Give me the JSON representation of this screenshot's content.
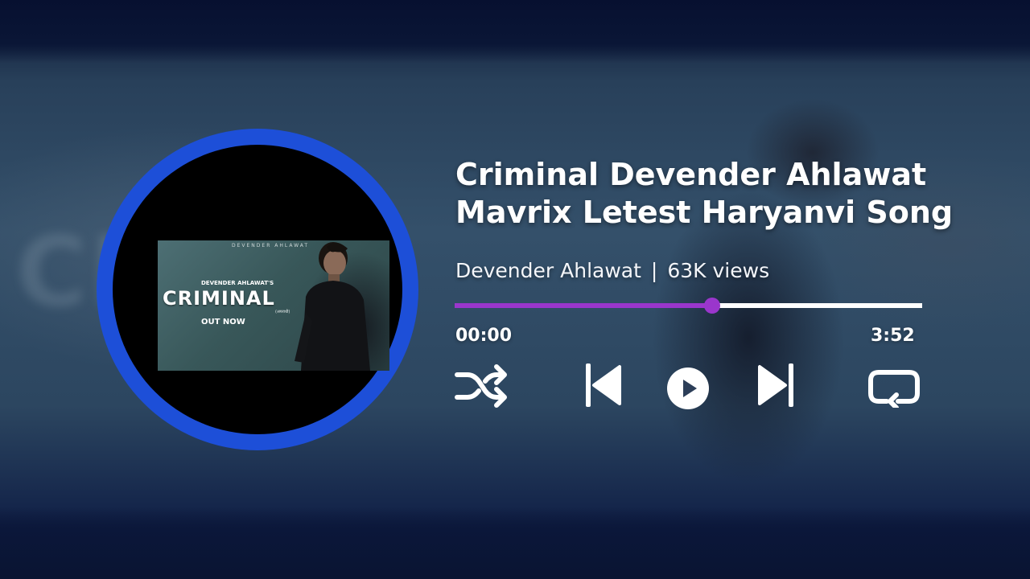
{
  "song": {
    "title_line1": "Criminal Devender Ahlawat",
    "title_line2": "Mavrix Letest Haryanvi Song",
    "artist": "Devender Ahlawat",
    "separator": "|",
    "views": "63K views"
  },
  "cover": {
    "top_text": "DEVENDER AHLAWAT",
    "artist_text": "DEVENDER AHLAWAT'S",
    "title_text": "CRIMINAL",
    "subtitle_text": "(अपराधी)",
    "release_text": "OUT NOW"
  },
  "background": {
    "ghost_text": "CRI"
  },
  "player": {
    "current_time": "00:00",
    "total_time": "3:52",
    "progress_fraction": 0.55,
    "controls": [
      "shuffle-icon",
      "previous-icon",
      "play-icon",
      "next-icon",
      "repeat-icon"
    ]
  },
  "colors": {
    "disc_ring": "#1d4fd8",
    "progress_fill": "#9a36cc",
    "progress_track": "#ffffff"
  }
}
